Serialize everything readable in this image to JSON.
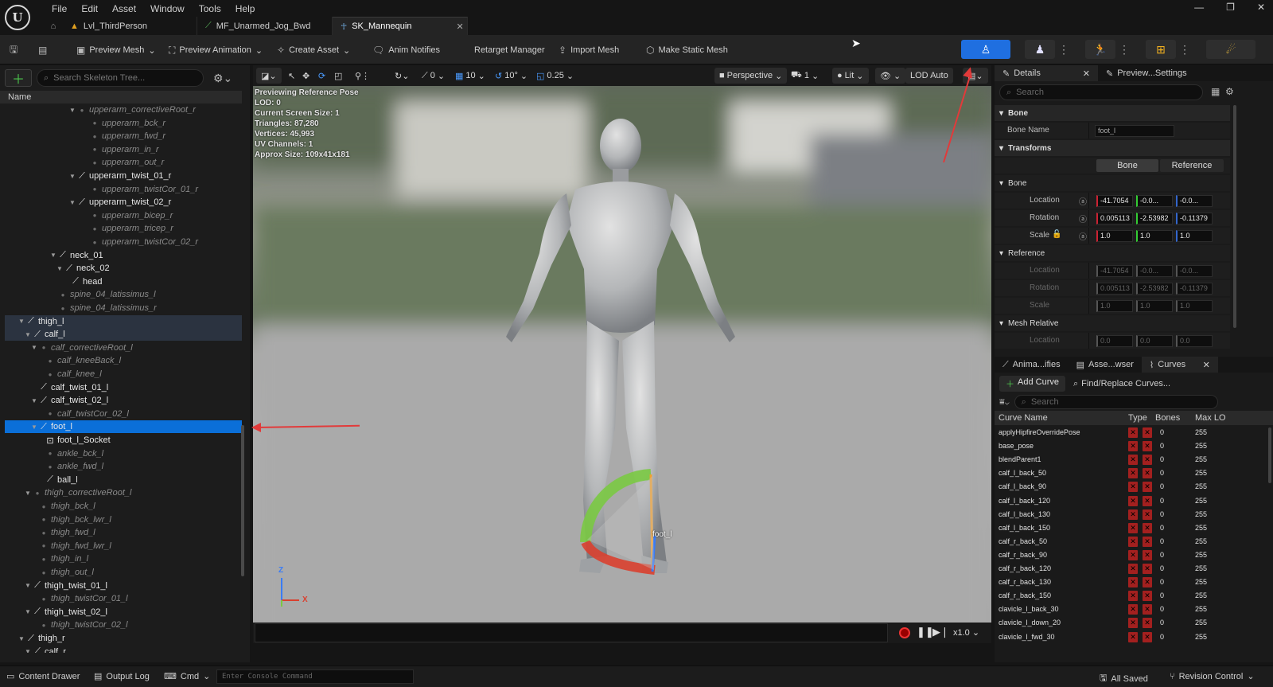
{
  "app": {
    "menu": [
      "File",
      "Edit",
      "Asset",
      "Window",
      "Tools",
      "Help"
    ],
    "tabs": [
      {
        "label": "Lvl_ThirdPerson",
        "icon": "level-icon",
        "active": false
      },
      {
        "label": "MF_Unarmed_Jog_Bwd",
        "icon": "anim-icon",
        "active": false
      },
      {
        "label": "SK_Mannequin",
        "icon": "skeleton-icon",
        "active": true
      }
    ]
  },
  "toolbar": {
    "preview_mesh": "Preview Mesh",
    "preview_animation": "Preview Animation",
    "create_asset": "Create Asset",
    "anim_notifies": "Anim Notifies",
    "retarget_manager": "Retarget Manager",
    "import_mesh": "Import Mesh",
    "make_static_mesh": "Make Static Mesh"
  },
  "skeleton_tree": {
    "search_placeholder": "Search Skeleton Tree...",
    "column_name": "Name",
    "rows": [
      {
        "label": "upperarm_correctiveRoot_r",
        "indent": 10,
        "kind": "virtual",
        "caret": true
      },
      {
        "label": "upperarm_bck_r",
        "indent": 12,
        "kind": "virtual"
      },
      {
        "label": "upperarm_fwd_r",
        "indent": 12,
        "kind": "virtual"
      },
      {
        "label": "upperarm_in_r",
        "indent": 12,
        "kind": "virtual"
      },
      {
        "label": "upperarm_out_r",
        "indent": 12,
        "kind": "virtual"
      },
      {
        "label": "upperarm_twist_01_r",
        "indent": 10,
        "kind": "bone",
        "caret": true
      },
      {
        "label": "upperarm_twistCor_01_r",
        "indent": 12,
        "kind": "virtual"
      },
      {
        "label": "upperarm_twist_02_r",
        "indent": 10,
        "kind": "bone",
        "caret": true
      },
      {
        "label": "upperarm_bicep_r",
        "indent": 12,
        "kind": "virtual"
      },
      {
        "label": "upperarm_tricep_r",
        "indent": 12,
        "kind": "virtual"
      },
      {
        "label": "upperarm_twistCor_02_r",
        "indent": 12,
        "kind": "virtual"
      },
      {
        "label": "neck_01",
        "indent": 7,
        "kind": "bone",
        "caret": true
      },
      {
        "label": "neck_02",
        "indent": 8,
        "kind": "bone",
        "caret": true
      },
      {
        "label": "head",
        "indent": 9,
        "kind": "bone"
      },
      {
        "label": "spine_04_latissimus_l",
        "indent": 7,
        "kind": "virtual"
      },
      {
        "label": "spine_04_latissimus_r",
        "indent": 7,
        "kind": "virtual"
      },
      {
        "label": "thigh_l",
        "indent": 2,
        "kind": "bone",
        "caret": true,
        "state": "highlight"
      },
      {
        "label": "calf_l",
        "indent": 3,
        "kind": "bone",
        "caret": true,
        "state": "highlight"
      },
      {
        "label": "calf_correctiveRoot_l",
        "indent": 4,
        "kind": "virtual",
        "caret": true
      },
      {
        "label": "calf_kneeBack_l",
        "indent": 5,
        "kind": "virtual"
      },
      {
        "label": "calf_knee_l",
        "indent": 5,
        "kind": "virtual"
      },
      {
        "label": "calf_twist_01_l",
        "indent": 4,
        "kind": "bone"
      },
      {
        "label": "calf_twist_02_l",
        "indent": 4,
        "kind": "bone",
        "caret": true
      },
      {
        "label": "calf_twistCor_02_l",
        "indent": 5,
        "kind": "virtual"
      },
      {
        "label": "foot_l",
        "indent": 4,
        "kind": "bone",
        "caret": true,
        "state": "selected"
      },
      {
        "label": "foot_l_Socket",
        "indent": 5,
        "kind": "socket"
      },
      {
        "label": "ankle_bck_l",
        "indent": 5,
        "kind": "virtual"
      },
      {
        "label": "ankle_fwd_l",
        "indent": 5,
        "kind": "virtual"
      },
      {
        "label": "ball_l",
        "indent": 5,
        "kind": "bone"
      },
      {
        "label": "thigh_correctiveRoot_l",
        "indent": 3,
        "kind": "virtual",
        "caret": true
      },
      {
        "label": "thigh_bck_l",
        "indent": 4,
        "kind": "virtual"
      },
      {
        "label": "thigh_bck_lwr_l",
        "indent": 4,
        "kind": "virtual"
      },
      {
        "label": "thigh_fwd_l",
        "indent": 4,
        "kind": "virtual"
      },
      {
        "label": "thigh_fwd_lwr_l",
        "indent": 4,
        "kind": "virtual"
      },
      {
        "label": "thigh_in_l",
        "indent": 4,
        "kind": "virtual"
      },
      {
        "label": "thigh_out_l",
        "indent": 4,
        "kind": "virtual"
      },
      {
        "label": "thigh_twist_01_l",
        "indent": 3,
        "kind": "bone",
        "caret": true
      },
      {
        "label": "thigh_twistCor_01_l",
        "indent": 4,
        "kind": "virtual"
      },
      {
        "label": "thigh_twist_02_l",
        "indent": 3,
        "kind": "bone",
        "caret": true
      },
      {
        "label": "thigh_twistCor_02_l",
        "indent": 4,
        "kind": "virtual"
      },
      {
        "label": "thigh_r",
        "indent": 2,
        "kind": "bone",
        "caret": true
      },
      {
        "label": "calf_r",
        "indent": 3,
        "kind": "bone",
        "caret": true
      }
    ]
  },
  "viewport": {
    "perspective": "Perspective",
    "lit": "Lit",
    "lod": "LOD Auto",
    "translate_snap": "0",
    "grid_snap": "10",
    "rotate_snap": "10°",
    "scale_snap": "0.25",
    "camera_speed": "1",
    "stats": [
      "Previewing Reference Pose",
      "LOD: 0",
      "Current Screen Size: 1",
      "Triangles: 87,280",
      "Vertices: 45,993",
      "UV Channels: 1",
      "Approx Size: 109x41x181"
    ],
    "bone_label": "foot_l",
    "axis_z": "Z",
    "axis_x": "X",
    "playback_speed": "x1.0"
  },
  "details": {
    "tab_details": "Details",
    "tab_preview": "Preview...Settings",
    "search_placeholder": "Search",
    "section_bone": "Bone",
    "bone_name_label": "Bone Name",
    "bone_name_value": "foot_l",
    "section_transforms": "Transforms",
    "toggle_bone": "Bone",
    "toggle_reference": "Reference",
    "sub_bone": "Bone",
    "sub_reference": "Reference",
    "sub_mesh_relative": "Mesh Relative",
    "location_label": "Location",
    "rotation_label": "Rotation",
    "scale_label": "Scale",
    "bone_location": [
      "-41.7054",
      "-0.0...",
      "-0.0..."
    ],
    "bone_rotation": [
      "0.005113",
      "-2.53982",
      "-0.11379"
    ],
    "bone_scale": [
      "1.0",
      "1.0",
      "1.0"
    ],
    "ref_location": [
      "-41.7054",
      "-0.0...",
      "-0.0..."
    ],
    "ref_rotation": [
      "0.005113",
      "-2.53982",
      "-0.11379"
    ],
    "ref_scale": [
      "1.0",
      "1.0",
      "1.0"
    ],
    "mesh_location": [
      "0.0",
      "0.0",
      "0.0"
    ]
  },
  "curves": {
    "tab_anim": "Anima...ifies",
    "tab_asset": "Asse...wser",
    "tab_curves": "Curves",
    "add_curve": "Add Curve",
    "find_replace": "Find/Replace Curves...",
    "search_placeholder": "Search",
    "col_name": "Curve Name",
    "col_type": "Type",
    "col_bones": "Bones",
    "col_maxlod": "Max LO",
    "rows": [
      {
        "name": "applyHipfireOverridePose",
        "bones": "0",
        "maxlod": "255"
      },
      {
        "name": "base_pose",
        "bones": "0",
        "maxlod": "255"
      },
      {
        "name": "blendParent1",
        "bones": "0",
        "maxlod": "255"
      },
      {
        "name": "calf_l_back_50",
        "bones": "0",
        "maxlod": "255"
      },
      {
        "name": "calf_l_back_90",
        "bones": "0",
        "maxlod": "255"
      },
      {
        "name": "calf_l_back_120",
        "bones": "0",
        "maxlod": "255"
      },
      {
        "name": "calf_l_back_130",
        "bones": "0",
        "maxlod": "255"
      },
      {
        "name": "calf_l_back_150",
        "bones": "0",
        "maxlod": "255"
      },
      {
        "name": "calf_r_back_50",
        "bones": "0",
        "maxlod": "255"
      },
      {
        "name": "calf_r_back_90",
        "bones": "0",
        "maxlod": "255"
      },
      {
        "name": "calf_r_back_120",
        "bones": "0",
        "maxlod": "255"
      },
      {
        "name": "calf_r_back_130",
        "bones": "0",
        "maxlod": "255"
      },
      {
        "name": "calf_r_back_150",
        "bones": "0",
        "maxlod": "255"
      },
      {
        "name": "clavicle_l_back_30",
        "bones": "0",
        "maxlod": "255"
      },
      {
        "name": "clavicle_l_down_20",
        "bones": "0",
        "maxlod": "255"
      },
      {
        "name": "clavicle_l_fwd_30",
        "bones": "0",
        "maxlod": "255"
      }
    ]
  },
  "statusbar": {
    "content_drawer": "Content Drawer",
    "output_log": "Output Log",
    "cmd": "Cmd",
    "console_placeholder": "Enter Console Command",
    "all_saved": "All Saved",
    "revision_control": "Revision Control"
  },
  "colors": {
    "selection": "#0b6fd8",
    "accent_button": "#1f6fe0",
    "annotation_arrow": "#e23a3a"
  }
}
